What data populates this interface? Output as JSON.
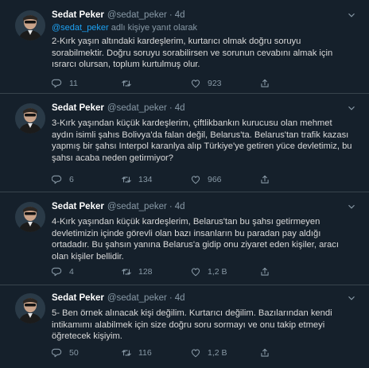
{
  "tweets": [
    {
      "name": "Sedat Peker",
      "handle": "@sedat_peker",
      "dot": "·",
      "time": "4d",
      "reply_mention": "@sedat_peker",
      "reply_suffix": " adlı kişiye yanıt olarak",
      "text": "2-Kırk yaşın altındaki kardeşlerim, kurtarıcı olmak doğru soruyu\nsorabilmektir. Doğru soruyu sorabilirsen ve sorunun cevabını almak için\nısrarcı olursan, toplum kurtulmuş olur.",
      "replies": "11",
      "retweets": "",
      "likes": "923"
    },
    {
      "name": "Sedat Peker",
      "handle": "@sedat_peker",
      "dot": "·",
      "time": "4d",
      "text": "3-Kırk yaşından küçük kardeşlerim, çiftlikbankın kurucusu olan mehmet\naydın isimli şahıs Bolivya'da falan değil, Belarus'ta. Belarus'tan trafik kazası\nyapmış bir şahsı Interpol karanlya alıp Türkiye'ye getiren yüce devletimiz, bu\nşahsı acaba neden getirmiyor?",
      "replies": "6",
      "retweets": "134",
      "likes": "966"
    },
    {
      "name": "Sedat Peker",
      "handle": "@sedat_peker",
      "dot": "·",
      "time": "4d",
      "text": "4-Kırk yaşından küçük kardeşlerim, Belarus'tan bu şahsı getirmeyen\ndevletimizin içinde görevli olan bazı insanların bu paradan pay aldığı\nortadadır. Bu şahsın yanına Belarus'a gidip onu ziyaret eden kişiler, aracı\nolan kişiler bellidir.",
      "replies": "4",
      "retweets": "128",
      "likes": "1,2 B"
    },
    {
      "name": "Sedat Peker",
      "handle": "@sedat_peker",
      "dot": "·",
      "time": "4d",
      "text": "5- Ben örnek alınacak kişi değilim. Kurtarıcı değilim. Bazılarından kendi\nintikamımı alabilmek için size doğru soru sormayı ve onu takip etmeyi\nöğretecek kişiyim.",
      "replies": "50",
      "retweets": "116",
      "likes": "1,2 B"
    }
  ],
  "icons": {
    "reply": "reply-icon",
    "retweet": "retweet-icon",
    "like": "heart-icon",
    "share": "share-icon",
    "more": "more-chevron-icon"
  },
  "colors": {
    "background": "#15202b",
    "text": "#d9d9d9",
    "secondary": "#8899a6",
    "accent": "#1da1f2",
    "divider": "#38444d"
  }
}
